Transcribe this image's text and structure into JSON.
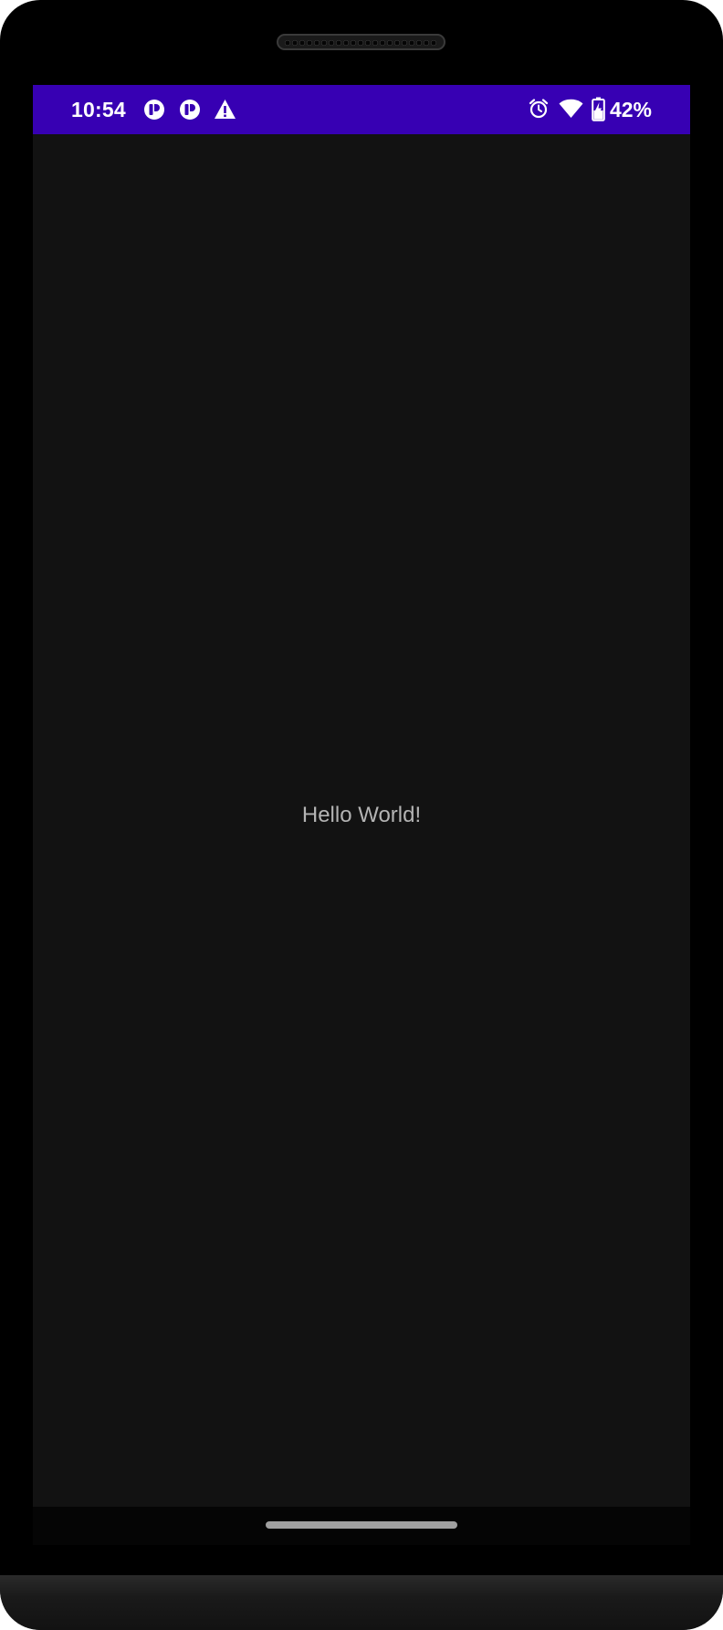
{
  "status_bar": {
    "time": "10:54",
    "battery_percent": "42%",
    "notification_icons": [
      "app-notification-icon",
      "app-notification-icon",
      "warning-icon"
    ],
    "system_icons": [
      "alarm-icon",
      "wifi-icon",
      "battery-charging-icon"
    ],
    "background_color": "#3700b3"
  },
  "main": {
    "message": "Hello World!"
  },
  "theme": {
    "screen_background": "#121212",
    "text_color": "#b3b3b3"
  }
}
